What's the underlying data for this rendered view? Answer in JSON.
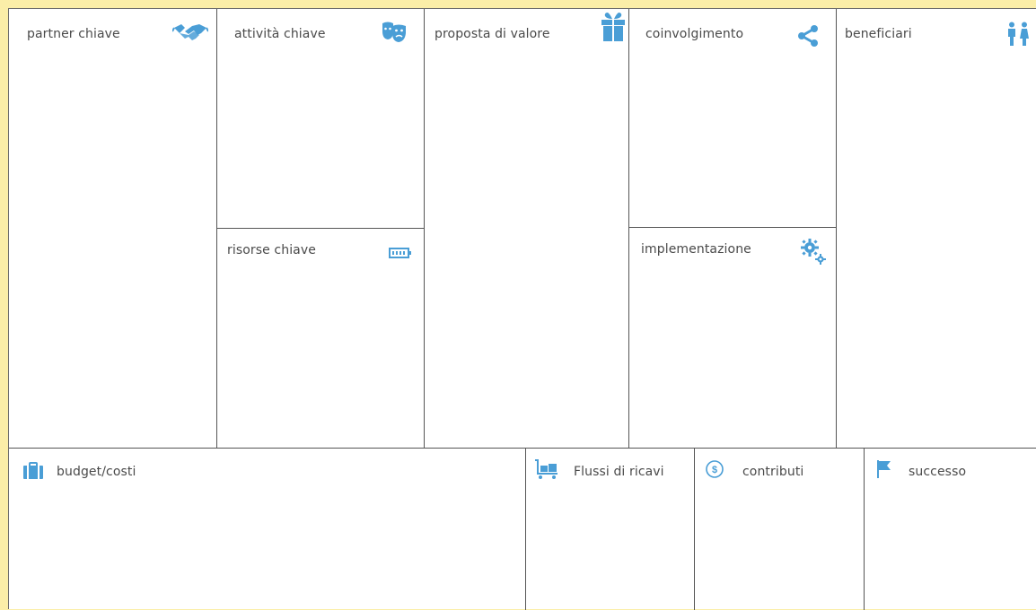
{
  "canvas": {
    "title": "",
    "accent_color": "#4a9ed6",
    "background_color": "#fbeea8",
    "line_color": "#555555"
  },
  "blocks": {
    "partners": {
      "label": "partner chiave",
      "icon": "handshake-icon"
    },
    "activities": {
      "label": "attività chiave",
      "icon": "theater-masks-icon"
    },
    "value": {
      "label": "proposta di valore",
      "icon": "gift-icon"
    },
    "engagement": {
      "label": "coinvolgimento",
      "icon": "share-icon"
    },
    "beneficiaries": {
      "label": "beneficiari",
      "icon": "people-icon"
    },
    "resources": {
      "label": "risorse chiave",
      "icon": "battery-icon"
    },
    "implementation": {
      "label": "implementazione",
      "icon": "gears-icon"
    },
    "budget": {
      "label": "budget/costi",
      "icon": "briefcase-icon"
    },
    "revenue": {
      "label": "Flussi di ricavi",
      "icon": "cart-icon"
    },
    "contributions": {
      "label": "contributi",
      "icon": "dollar-coin-icon"
    },
    "success": {
      "label": "successo",
      "icon": "flag-icon"
    }
  }
}
